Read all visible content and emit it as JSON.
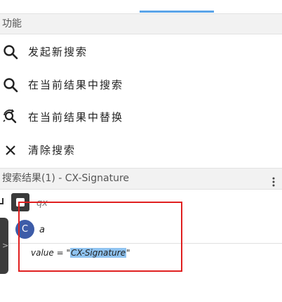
{
  "header": {
    "functions_title": "功能"
  },
  "menu": [
    {
      "label": "发起新搜索",
      "icon": "search-icon"
    },
    {
      "label": "在当前结果中搜索",
      "icon": "search-icon"
    },
    {
      "label": "在当前结果中替换",
      "icon": "replace-icon"
    },
    {
      "label": "清除搜索",
      "icon": "close-icon"
    }
  ],
  "results": {
    "title": "搜索结果(1) - CX-Signature",
    "node1": "qx",
    "avatar_letter": "C",
    "node2": "a",
    "value_prefix": "value = \"",
    "value_match": "CX-Signature",
    "value_suffix": "\""
  },
  "colors": {
    "accent": "#5aa4e8",
    "highlight": "#8fc3f0",
    "annotation": "#e02020",
    "avatar": "#3d5ca8"
  }
}
